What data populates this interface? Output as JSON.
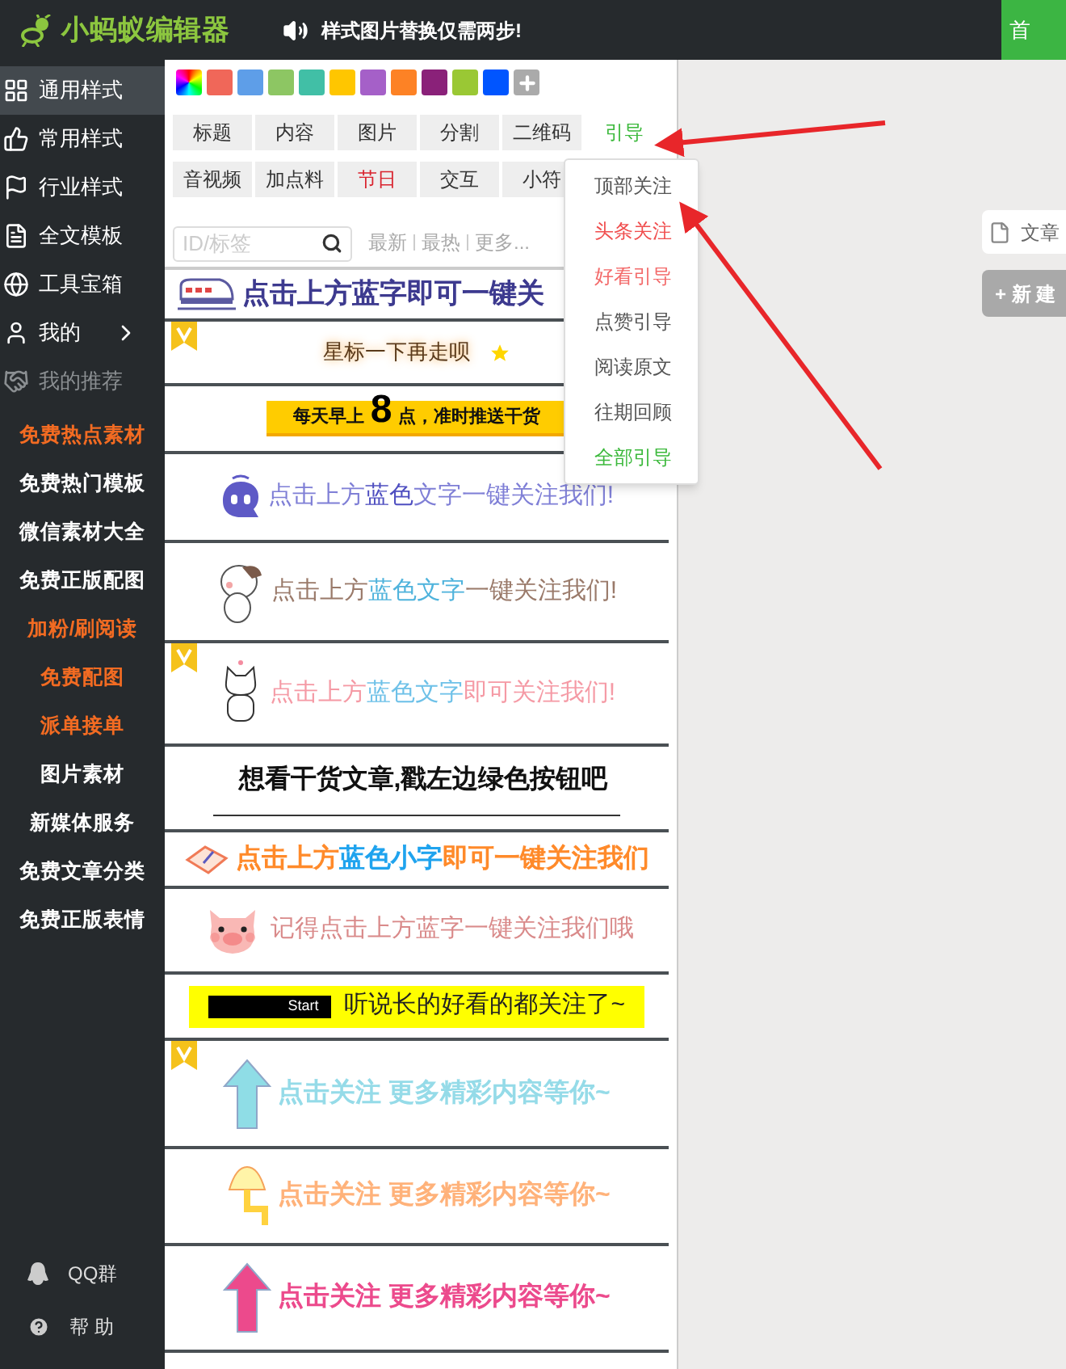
{
  "header": {
    "logo": "小蚂蚁编辑器",
    "notice": "样式图片替换仅需两步!",
    "action": "首"
  },
  "sidebar": {
    "nav": [
      {
        "label": "通用样式",
        "selected": true,
        "disabled": false,
        "expandable": false
      },
      {
        "label": "常用样式",
        "selected": false,
        "disabled": false,
        "expandable": false
      },
      {
        "label": "行业样式",
        "selected": false,
        "disabled": false,
        "expandable": false
      },
      {
        "label": "全文模板",
        "selected": false,
        "disabled": false,
        "expandable": false
      },
      {
        "label": "工具宝箱",
        "selected": false,
        "disabled": false,
        "expandable": false
      },
      {
        "label": "我的",
        "selected": false,
        "disabled": false,
        "expandable": true
      },
      {
        "label": "我的推荐",
        "selected": false,
        "disabled": true,
        "expandable": false
      }
    ],
    "links": [
      {
        "label": "免费热点素材",
        "color": "#f26b22"
      },
      {
        "label": "免费热门模板",
        "color": "#ffffff"
      },
      {
        "label": "微信素材大全",
        "color": "#ffffff"
      },
      {
        "label": "免费正版配图",
        "color": "#ffffff"
      },
      {
        "label": "加粉/刷阅读",
        "color": "#f26b22"
      },
      {
        "label": "免费配图",
        "color": "#f26b22"
      },
      {
        "label": "派单接单",
        "color": "#f26b22"
      },
      {
        "label": "图片素材",
        "color": "#ffffff"
      },
      {
        "label": "新媒体服务",
        "color": "#ffffff"
      },
      {
        "label": "免费文章分类",
        "color": "#ffffff"
      },
      {
        "label": "免费正版表情",
        "color": "#ffffff"
      }
    ],
    "footer": [
      {
        "kind": "qq",
        "label": "QQ群"
      },
      {
        "kind": "help",
        "label": "帮 助"
      }
    ]
  },
  "swatches": [
    {
      "kind": "rainbow"
    },
    {
      "kind": "color",
      "color": "#f06759"
    },
    {
      "kind": "color",
      "color": "#5e9ee8"
    },
    {
      "kind": "color",
      "color": "#8dc663"
    },
    {
      "kind": "color",
      "color": "#41bfa6"
    },
    {
      "kind": "color",
      "color": "#ffc600"
    },
    {
      "kind": "color",
      "color": "#a560c8"
    },
    {
      "kind": "color",
      "color": "#fd8225"
    },
    {
      "kind": "color",
      "color": "#8a2179"
    },
    {
      "kind": "color",
      "color": "#9ac834"
    },
    {
      "kind": "color",
      "color": "#0055ff"
    },
    {
      "kind": "add"
    }
  ],
  "tabs": [
    [
      {
        "label": "标题",
        "selected": false,
        "color": "#333333"
      },
      {
        "label": "内容",
        "selected": false,
        "color": "#333333"
      },
      {
        "label": "图片",
        "selected": false,
        "color": "#333333"
      },
      {
        "label": "分割",
        "selected": false,
        "color": "#333333"
      },
      {
        "label": "二维码",
        "selected": false,
        "color": "#333333"
      },
      {
        "label": "引导",
        "selected": true,
        "color": "#3cb93c"
      }
    ],
    [
      {
        "label": "音视频",
        "selected": false,
        "color": "#333333"
      },
      {
        "label": "加点料",
        "selected": false,
        "color": "#333333"
      },
      {
        "label": "节日",
        "selected": false,
        "color": "#d9232e"
      },
      {
        "label": "交互",
        "selected": false,
        "color": "#333333"
      },
      {
        "label": "小符",
        "selected": false,
        "color": "#333333"
      }
    ]
  ],
  "search": {
    "placeholder": "ID/标签"
  },
  "sort_links": [
    "最新",
    "最热",
    "更多..."
  ],
  "cards": [
    {
      "kind": "train",
      "badge": false,
      "parts": [
        {
          "text": "点击上方蓝字即可一键关",
          "color": "#3d3a8f",
          "big": false
        }
      ]
    },
    {
      "kind": "star",
      "badge": true,
      "parts": [
        {
          "text": "星标一下再走呗",
          "color": "#5a3a1a",
          "big": false
        }
      ]
    },
    {
      "kind": "banner",
      "badge": false,
      "parts": [
        {
          "text": "每天早上",
          "color": "#111111",
          "big": false
        },
        {
          "text": "8",
          "color": "#000000",
          "big": true
        },
        {
          "text": "点，准时推送干货",
          "color": "#111111",
          "big": false
        }
      ]
    },
    {
      "kind": "ghost",
      "badge": false,
      "parts": [
        {
          "text": "点击上方",
          "color": "#7f7fd6",
          "big": false
        },
        {
          "text": "蓝色",
          "color": "#4f4fc0",
          "big": false
        },
        {
          "text": "文字一键关注我们!",
          "color": "#7f7fd6",
          "big": false
        }
      ]
    },
    {
      "kind": "dog",
      "badge": false,
      "parts": [
        {
          "text": "点击上方",
          "color": "#9a7a6a",
          "big": false
        },
        {
          "text": "蓝色文字",
          "color": "#4fb3dc",
          "big": false
        },
        {
          "text": "一键关注我们!",
          "color": "#9a7a6a",
          "big": false
        }
      ]
    },
    {
      "kind": "cat",
      "badge": true,
      "parts": [
        {
          "text": "点击上方",
          "color": "#f59aa5",
          "big": false
        },
        {
          "text": "蓝色文字",
          "color": "#6ec1e8",
          "big": false
        },
        {
          "text": "即可关注我们!",
          "color": "#f59aa5",
          "big": false
        }
      ]
    },
    {
      "kind": "finger",
      "badge": false,
      "parts": [
        {
          "text": "想看干货文章,戳左边绿色按钮吧",
          "color": "#111111",
          "big": false
        }
      ]
    },
    {
      "kind": "notebook",
      "badge": false,
      "parts": [
        {
          "text": "点击上方",
          "color": "#ff8a2a",
          "big": false
        },
        {
          "text": "蓝色小字",
          "color": "#1fa3ee",
          "big": false
        },
        {
          "text": "即可一键关注我们",
          "color": "#ff8a2a",
          "big": false
        }
      ]
    },
    {
      "kind": "pig",
      "badge": false,
      "parts": [
        {
          "text": "记得点击上方蓝字一键关注我们哦",
          "color": "#d98a8a",
          "big": false
        }
      ]
    },
    {
      "kind": "start",
      "badge": false,
      "button": "Start",
      "parts": [
        {
          "text": "听说长的好看的都关注了~",
          "color": "#222222",
          "big": false
        }
      ]
    },
    {
      "kind": "arrow",
      "badge": true,
      "color": "#8fdde6",
      "parts": [
        {
          "text": "点击关注 更多精彩内容等你~",
          "color": "#95dbe8",
          "big": false
        }
      ]
    },
    {
      "kind": "umbrella",
      "badge": false,
      "parts": [
        {
          "text": "点击关注 更多精彩内容等你~",
          "color": "#ffb27a",
          "big": false
        }
      ]
    },
    {
      "kind": "arrow",
      "badge": false,
      "color": "#ec4a8c",
      "parts": [
        {
          "text": "点击关注 更多精彩内容等你~",
          "color": "#ec4a8c",
          "big": false
        }
      ]
    }
  ],
  "dropdown": [
    {
      "label": "顶部关注",
      "color": "#555555"
    },
    {
      "label": "头条关注",
      "color": "#f04e4e"
    },
    {
      "label": "好看引导",
      "color": "#f36a6a"
    },
    {
      "label": "点赞引导",
      "color": "#555555"
    },
    {
      "label": "阅读原文",
      "color": "#555555"
    },
    {
      "label": "往期回顾",
      "color": "#555555"
    },
    {
      "label": "全部引导",
      "color": "#3cb93c"
    }
  ],
  "right": {
    "doc_tab": "文章",
    "new_button": "+ 新 建"
  }
}
